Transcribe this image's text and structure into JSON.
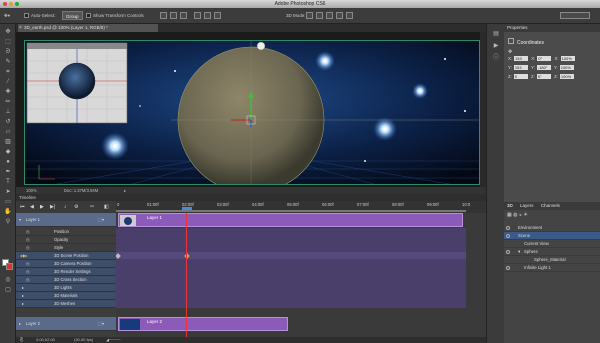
{
  "window": {
    "title": "Adobe Photoshop CS6"
  },
  "options_bar": {
    "auto_select_label": "Auto-Select:",
    "auto_select_value": "Group",
    "show_transform_label": "Show Transform Controls",
    "mode_label": "3D Mode:"
  },
  "document": {
    "tab_title": "3D_earth.psd @ 100% (Layer 1, RGB/8) *",
    "zoom": "100%",
    "doc_info": "Doc: 1.37M/3.94M"
  },
  "properties": {
    "tab": "Properties",
    "section": "Coordinates",
    "rows": [
      {
        "axis": "X:",
        "pos": "153",
        "rot_axis": "X:",
        "rot": "0°",
        "scale_axis": "X:",
        "scale": "100%"
      },
      {
        "axis": "Y:",
        "pos": "153",
        "rot_axis": "Y:",
        "rot": "-180°",
        "scale_axis": "Y:",
        "scale": "100%"
      },
      {
        "axis": "Z:",
        "pos": "0",
        "rot_axis": "Z:",
        "rot": "0°",
        "scale_axis": "Z:",
        "scale": "100%"
      }
    ]
  },
  "layers_panel": {
    "tabs": [
      "3D",
      "Layers",
      "Channels"
    ],
    "items": [
      "Environment",
      "Scene",
      "Current View",
      "Sphere",
      "Sphere_Material",
      "Infinite Light 1"
    ]
  },
  "timeline": {
    "title": "Timeline",
    "ruler_ticks": [
      "0",
      "01:00f",
      "02:00f",
      "03:00f",
      "04:00f",
      "05:00f",
      "06:00f",
      "07:00f",
      "08:00f",
      "09:00f",
      "10:0"
    ],
    "tracks": [
      "Layer 1",
      "Position",
      "Opacity",
      "Style",
      "3D Scene Position",
      "3D Camera Position",
      "3D Render Settings",
      "3D Cross Section",
      "3D Lights",
      "3D Materials",
      "3D Meshes"
    ],
    "track2": "Layer 2",
    "clip1_label": "Layer 1",
    "clip2_label": "Layer 2",
    "current_time": "0:00:02:00",
    "fps": "(30.00 fps)"
  }
}
